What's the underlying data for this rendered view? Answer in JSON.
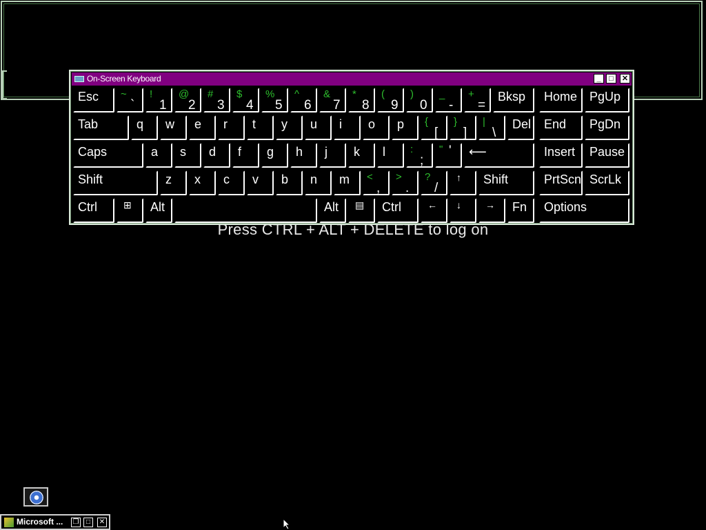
{
  "logon": {
    "message": "Press CTRL + ALT + DELETE to log on"
  },
  "window": {
    "title": "On-Screen Keyboard",
    "minimize": "_",
    "maximize": "□",
    "close": "✕"
  },
  "keys": {
    "esc": "Esc",
    "tilde": {
      "shift": "~",
      "base": "`"
    },
    "d1": {
      "shift": "!",
      "base": "1"
    },
    "d2": {
      "shift": "@",
      "base": "2"
    },
    "d3": {
      "shift": "#",
      "base": "3"
    },
    "d4": {
      "shift": "$",
      "base": "4"
    },
    "d5": {
      "shift": "%",
      "base": "5"
    },
    "d6": {
      "shift": "^",
      "base": "6"
    },
    "d7": {
      "shift": "&",
      "base": "7"
    },
    "d8": {
      "shift": "*",
      "base": "8"
    },
    "d9": {
      "shift": "(",
      "base": "9"
    },
    "d0": {
      "shift": ")",
      "base": "0"
    },
    "minus": {
      "shift": "_",
      "base": "-"
    },
    "equals": {
      "shift": "+",
      "base": "="
    },
    "bksp": "Bksp",
    "home": "Home",
    "pgup": "PgUp",
    "tab": "Tab",
    "q": "q",
    "w": "w",
    "e": "e",
    "r": "r",
    "t": "t",
    "y": "y",
    "u": "u",
    "i": "i",
    "o": "o",
    "p": "p",
    "lbracket": {
      "shift": "{",
      "base": "["
    },
    "rbracket": {
      "shift": "}",
      "base": "]"
    },
    "backslash": {
      "shift": "|",
      "base": "\\"
    },
    "del": "Del",
    "end": "End",
    "pgdn": "PgDn",
    "caps": "Caps",
    "a": "a",
    "s": "s",
    "d": "d",
    "f": "f",
    "g": "g",
    "h": "h",
    "j": "j",
    "k": "k",
    "l": "l",
    "semicolon": {
      "shift": ":",
      "base": ";"
    },
    "quote": {
      "shift": "\"",
      "base": "'"
    },
    "enter": "⟵",
    "insert": "Insert",
    "pause": "Pause",
    "lshift": "Shift",
    "z": "z",
    "x": "x",
    "c": "c",
    "v": "v",
    "b": "b",
    "n": "n",
    "m": "m",
    "comma": {
      "shift": "<",
      "base": ","
    },
    "period": {
      "shift": ">",
      "base": "."
    },
    "slash": {
      "shift": "?",
      "base": "/"
    },
    "up": "↑",
    "rshift": "Shift",
    "prtscn": "PrtScn",
    "scrlk": "ScrLk",
    "lctrl": "Ctrl",
    "win": "⊞",
    "lalt": "Alt",
    "ralt": "Alt",
    "menu": "▤",
    "rctrl": "Ctrl",
    "left": "←",
    "down": "↓",
    "right": "→",
    "fn": "Fn",
    "options": "Options"
  },
  "taskbar": {
    "button_label": "Microsoft ...",
    "restore": "❐",
    "maximize": "□",
    "close": "✕"
  },
  "icons": {
    "ease_of_access": "ease-of-access-icon",
    "keyboard": "keyboard-icon",
    "app": "app-icon",
    "cursor": "mouse-cursor-icon"
  },
  "colors": {
    "titlebar": "#800080",
    "shift_char": "#2dbd2d",
    "background": "#000000"
  }
}
